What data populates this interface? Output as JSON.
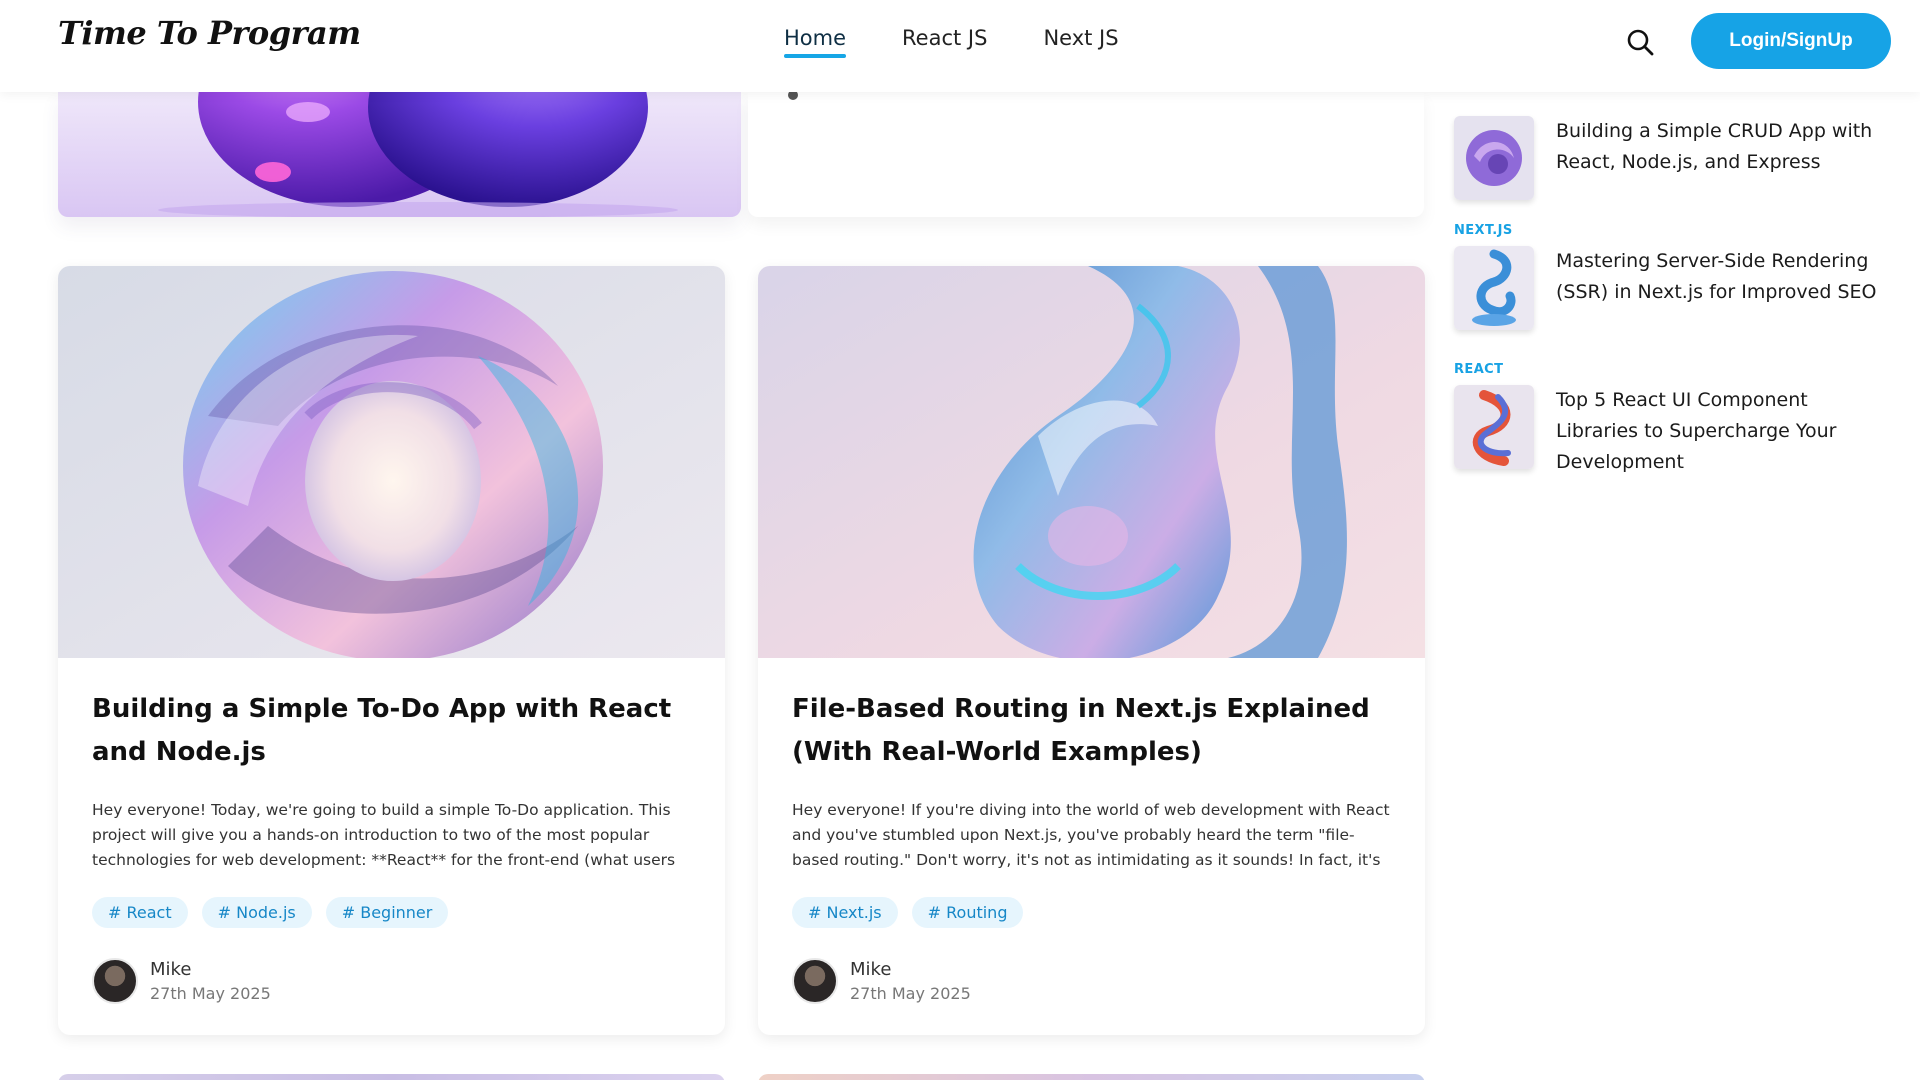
{
  "header": {
    "logo": "Time To Program",
    "nav": [
      {
        "label": "Home",
        "active": true
      },
      {
        "label": "React JS",
        "active": false
      },
      {
        "label": "Next JS",
        "active": false
      }
    ],
    "search_icon": "search-icon",
    "login_label": "Login/SignUp",
    "accent_color": "#16a3e6"
  },
  "posts": [
    {
      "title": "Building a Simple To-Do App with React and Node.js",
      "excerpt": "Hey everyone! Today, we're going to build a simple To-Do application. This project will give you a hands-on introduction to two of the most popular technologies for web development: **React** for the front-end (what users see...",
      "tags": [
        "# React",
        "# Node.js",
        "# Beginner"
      ],
      "author": "Mike",
      "date": "27th May 2025"
    },
    {
      "title": "File-Based Routing in Next.js Explained (With Real-World Examples)",
      "excerpt": "Hey everyone! If you're diving into the world of web development with React and you've stumbled upon Next.js, you've probably heard the term \"file-based routing.\" Don't worry, it's not as intimidating as it sounds! In fact, it's one of the...",
      "tags": [
        "# Next.js",
        "# Routing"
      ],
      "author": "Mike",
      "date": "27th May 2025"
    }
  ],
  "sidebar": {
    "items": [
      {
        "category": "",
        "title": "Building a Simple CRUD App with React, Node.js, and Express"
      },
      {
        "category": "NEXT.JS",
        "title": "Mastering Server-Side Rendering (SSR) in Next.js for Improved SEO"
      },
      {
        "category": "REACT",
        "title": "Top 5 React UI Component Libraries to Supercharge Your Development"
      }
    ]
  }
}
